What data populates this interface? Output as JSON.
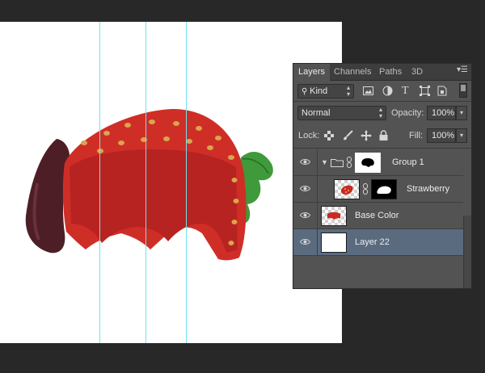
{
  "layers_panel": {
    "tabs": [
      {
        "label": "Layers",
        "active": true
      },
      {
        "label": "Channels",
        "active": false
      },
      {
        "label": "Paths",
        "active": false
      },
      {
        "label": "3D",
        "active": false
      }
    ],
    "panel_menu_icon": "panel-menu-icon",
    "filter": {
      "label": "Kind"
    },
    "blend_mode": "Normal",
    "opacity": {
      "label": "Opacity:",
      "value": "100%"
    },
    "lock": {
      "label": "Lock:"
    },
    "fill": {
      "label": "Fill:",
      "value": "100%"
    },
    "layers": [
      {
        "name": "Group 1",
        "type": "group",
        "visible": true,
        "selected": false
      },
      {
        "name": "Strawberry",
        "type": "masked",
        "visible": true,
        "selected": false
      },
      {
        "name": "Base Color",
        "type": "pixel",
        "visible": true,
        "selected": false
      },
      {
        "name": "Layer 22",
        "type": "pixel",
        "visible": true,
        "selected": true
      }
    ]
  },
  "colors": {
    "workspace": "#282828",
    "panel": "#535353",
    "selected_layer": "#5a6b80",
    "guide": "#6fe3ee",
    "strawberry_red": "#c92a25",
    "leaf_green": "#3e9a3a"
  }
}
